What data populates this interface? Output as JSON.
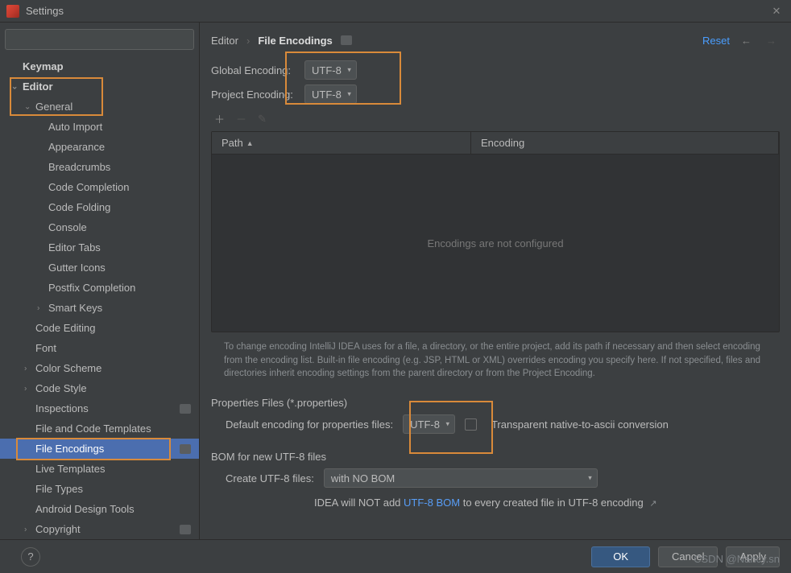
{
  "window": {
    "title": "Settings"
  },
  "sidebar": {
    "search_placeholder": "",
    "items": [
      {
        "label": "Keymap",
        "bold": true,
        "lvl": 0
      },
      {
        "label": "Editor",
        "bold": true,
        "lvl": 0,
        "arrow": "down"
      },
      {
        "label": "General",
        "bold": false,
        "lvl": 1,
        "arrow": "down"
      },
      {
        "label": "Auto Import",
        "lvl": 2
      },
      {
        "label": "Appearance",
        "lvl": 2
      },
      {
        "label": "Breadcrumbs",
        "lvl": 2
      },
      {
        "label": "Code Completion",
        "lvl": 2
      },
      {
        "label": "Code Folding",
        "lvl": 2
      },
      {
        "label": "Console",
        "lvl": 2
      },
      {
        "label": "Editor Tabs",
        "lvl": 2
      },
      {
        "label": "Gutter Icons",
        "lvl": 2
      },
      {
        "label": "Postfix Completion",
        "lvl": 2
      },
      {
        "label": "Smart Keys",
        "lvl": 2,
        "arrow": "right"
      },
      {
        "label": "Code Editing",
        "lvl": 1
      },
      {
        "label": "Font",
        "lvl": 1
      },
      {
        "label": "Color Scheme",
        "lvl": 1,
        "arrow": "right"
      },
      {
        "label": "Code Style",
        "lvl": 1,
        "arrow": "right"
      },
      {
        "label": "Inspections",
        "lvl": 1,
        "badge": true
      },
      {
        "label": "File and Code Templates",
        "lvl": 1
      },
      {
        "label": "File Encodings",
        "lvl": 1,
        "selected": true,
        "badge": true
      },
      {
        "label": "Live Templates",
        "lvl": 1
      },
      {
        "label": "File Types",
        "lvl": 1
      },
      {
        "label": "Android Design Tools",
        "lvl": 1
      },
      {
        "label": "Copyright",
        "lvl": 1,
        "arrow": "right",
        "badge": true
      }
    ]
  },
  "breadcrumb": {
    "a": "Editor",
    "b": "File Encodings",
    "reset": "Reset"
  },
  "encodings": {
    "global_label": "Global Encoding:",
    "global_value": "UTF-8",
    "project_label": "Project Encoding:",
    "project_value": "UTF-8"
  },
  "table": {
    "path_header": "Path",
    "encoding_header": "Encoding",
    "empty": "Encodings are not configured"
  },
  "help_text": "To change encoding IntelliJ IDEA uses for a file, a directory, or the entire project, add its path if necessary and then select encoding from the encoding list. Built-in file encoding (e.g. JSP, HTML or XML) overrides encoding you specify here. If not specified, files and directories inherit encoding settings from the parent directory or from the Project Encoding.",
  "properties": {
    "section": "Properties Files (*.properties)",
    "default_label": "Default encoding for properties files:",
    "default_value": "UTF-8",
    "transparent": "Transparent native-to-ascii conversion"
  },
  "bom": {
    "section": "BOM for new UTF-8 files",
    "create_label": "Create UTF-8 files:",
    "create_value": "with NO BOM",
    "note_pre": "IDEA will NOT add ",
    "note_link": "UTF-8 BOM",
    "note_post": " to every created file in UTF-8 encoding"
  },
  "buttons": {
    "ok": "OK",
    "cancel": "Cancel",
    "apply": "Apply"
  },
  "watermark": "CSDN @Nancy.sn"
}
